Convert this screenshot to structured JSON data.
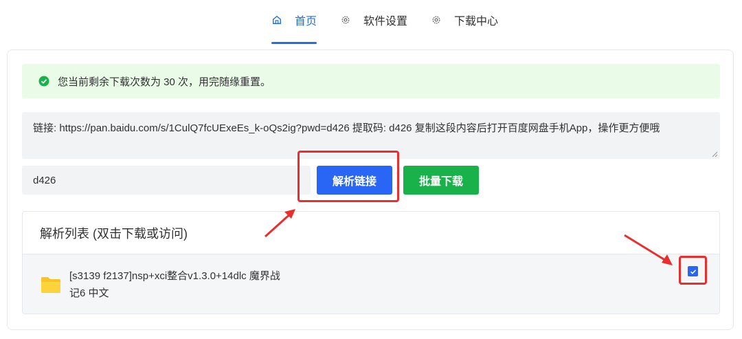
{
  "nav": {
    "tabs": [
      {
        "label": "首页",
        "icon": "home-icon",
        "active": true
      },
      {
        "label": "软件设置",
        "icon": "gear-icon",
        "active": false
      },
      {
        "label": "下载中心",
        "icon": "gear-icon",
        "active": false
      }
    ]
  },
  "alert": {
    "icon": "check-circle-icon",
    "text": "您当前剩余下载次数为 30 次，用完随缘重置。"
  },
  "link_input": {
    "value": "链接: https://pan.baidu.com/s/1CulQ7fcUExeEs_k-oQs2ig?pwd=d426 提取码: d426 复制这段内容后打开百度网盘手机App，操作更方便哦"
  },
  "password_input": {
    "value": "d426"
  },
  "buttons": {
    "parse_label": "解析链接",
    "batch_label": "批量下载"
  },
  "list": {
    "title": "解析列表 (双击下载或访问)",
    "items": [
      {
        "icon": "folder-icon",
        "name_line1": "[s3139 f2137]nsp+xci整合v1.3.0+14dlc 魔界战",
        "name_line2": "记6 中文",
        "checked": true
      }
    ]
  },
  "colors": {
    "primary": "#2a66f5",
    "success": "#18b14a",
    "alert_bg": "#eafbe7",
    "annotation_red": "#ea2d2d"
  }
}
